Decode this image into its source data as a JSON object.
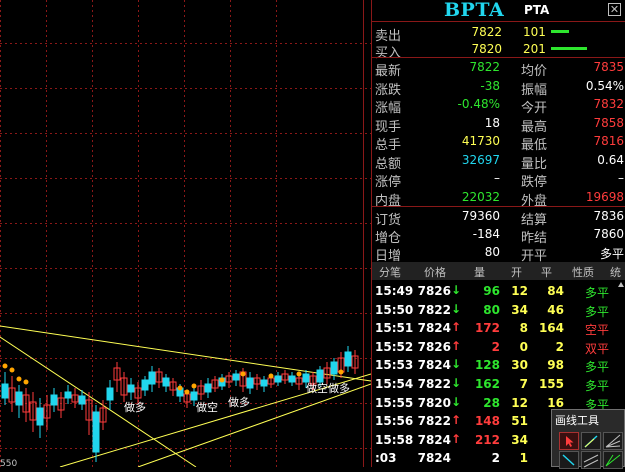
{
  "header": {
    "symbol": "BPTA",
    "symbol_sub": "PTA",
    "close_glyph": "✕"
  },
  "colors": {
    "up": "#ff3c3c",
    "down": "#2ee62e",
    "neutral": "#ffffff",
    "accent": "#21d6ee",
    "grid": "#8a1818"
  },
  "orderbook": [
    {
      "label": "卖出",
      "price": "7822",
      "volume": "101",
      "bar": 0.25
    },
    {
      "label": "买入",
      "price": "7820",
      "volume": "201",
      "bar": 0.5
    }
  ],
  "quote_rows": [
    {
      "l1": "最新",
      "v1": "7822",
      "c1": "grn",
      "l2": "均价",
      "v2": "7835",
      "c2": "red"
    },
    {
      "l1": "涨跌",
      "v1": "-38",
      "c1": "grn",
      "l2": "振幅",
      "v2": "0.54%",
      "c2": "wht"
    },
    {
      "l1": "涨幅",
      "v1": "-0.48%",
      "c1": "grn",
      "l2": "今开",
      "v2": "7832",
      "c2": "red"
    },
    {
      "l1": "现手",
      "v1": "18",
      "c1": "wht",
      "l2": "最高",
      "v2": "7858",
      "c2": "red"
    },
    {
      "l1": "总手",
      "v1": "41730",
      "c1": "yel",
      "l2": "最低",
      "v2": "7816",
      "c2": "red"
    },
    {
      "l1": "总额",
      "v1": "32697",
      "c1": "cyn",
      "l2": "量比",
      "v2": "0.64",
      "c2": "wht"
    },
    {
      "l1": "涨停",
      "v1": "–",
      "c1": "wht",
      "l2": "跌停",
      "v2": "–",
      "c2": "wht"
    },
    {
      "l1": "内盘",
      "v1": "22032",
      "c1": "grn",
      "l2": "外盘",
      "v2": "19698",
      "c2": "red"
    }
  ],
  "settle_rows": [
    {
      "l1": "订货",
      "v1": "79360",
      "l2": "结算",
      "v2": "7836"
    },
    {
      "l1": "增仓",
      "v1": "-184",
      "l2": "昨结",
      "v2": "7860"
    },
    {
      "l1": "日增",
      "v1": "80",
      "l2": "开平",
      "v2": "多平"
    }
  ],
  "ticks_header": {
    "c0": "分笔",
    "c1": "价格",
    "c2": "量",
    "c3": "开",
    "c4": "平",
    "c5": "性质",
    "c6": "统"
  },
  "ticks": [
    {
      "time": "15:49",
      "price": "7826",
      "dir": "down",
      "vol": "96",
      "open": "12",
      "close": "84",
      "nature": "多平",
      "nc": "grn"
    },
    {
      "time": "15:50",
      "price": "7822",
      "dir": "down",
      "vol": "80",
      "open": "34",
      "close": "46",
      "nature": "多平",
      "nc": "grn"
    },
    {
      "time": "15:51",
      "price": "7824",
      "dir": "up",
      "vol": "172",
      "open": "8",
      "close": "164",
      "nature": "空平",
      "nc": "red"
    },
    {
      "time": "15:52",
      "price": "7826",
      "dir": "up",
      "vol": "2",
      "open": "0",
      "close": "2",
      "nature": "双平",
      "nc": "red"
    },
    {
      "time": "15:53",
      "price": "7824",
      "dir": "down",
      "vol": "128",
      "open": "30",
      "close": "98",
      "nature": "多平",
      "nc": "grn"
    },
    {
      "time": "15:54",
      "price": "7822",
      "dir": "down",
      "vol": "162",
      "open": "7",
      "close": "155",
      "nature": "多平",
      "nc": "grn"
    },
    {
      "time": "15:55",
      "price": "7820",
      "dir": "down",
      "vol": "28",
      "open": "12",
      "close": "16",
      "nature": "多平",
      "nc": "grn"
    },
    {
      "time": "15:56",
      "price": "7822",
      "dir": "up",
      "vol": "148",
      "open": "51",
      "close": "",
      "nature": "",
      "nc": "red"
    },
    {
      "time": "15:58",
      "price": "7824",
      "dir": "up",
      "vol": "212",
      "open": "34",
      "close": "",
      "nature": "",
      "nc": "red"
    },
    {
      "time": ":03",
      "price": "7824",
      "dir": "none",
      "vol": "2",
      "open": "1",
      "close": "",
      "nature": "",
      "nc": "wht"
    }
  ],
  "chart": {
    "y_label_bottom": "550",
    "annotations": [
      "做多",
      "做空",
      "做多",
      "做空做多"
    ]
  },
  "tools": {
    "title": "画线工具"
  }
}
